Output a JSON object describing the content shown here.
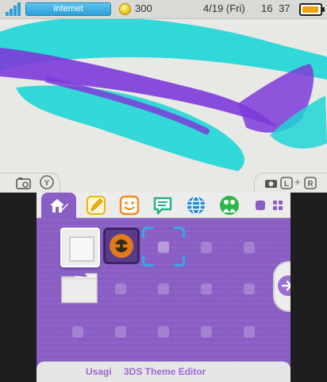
{
  "status_bar": {
    "connection_label": "Internet",
    "coin_count": "300",
    "date": "4/19 (Fri)",
    "time": "16 37",
    "icons": [
      "signal-strength-icon",
      "coin-icon",
      "battery-icon"
    ]
  },
  "top_controls": {
    "left_tab_icons": [
      "camera-icon",
      "y-button-icon"
    ],
    "right_tab_icons": [
      "camera-icon",
      "l-button-icon",
      "r-button-icon"
    ],
    "right_tab_plus": "+"
  },
  "app_bar": {
    "apps": [
      {
        "name": "home-settings-icon",
        "color": "#8a5ec4"
      },
      {
        "name": "notes-pencil-icon",
        "color": "#f2b400"
      },
      {
        "name": "friends-smiley-icon",
        "color": "#f28a1e"
      },
      {
        "name": "notifications-speech-icon",
        "color": "#23b08a"
      },
      {
        "name": "browser-globe-icon",
        "color": "#1c8bd8"
      },
      {
        "name": "miiverse-icon",
        "color": "#2fb84a"
      }
    ],
    "layout_icons": [
      "single-view-icon",
      "grid-view-icon"
    ]
  },
  "theme": {
    "accent_color": "#8a5ec4",
    "wallpaper_colors": [
      "#1fd6d6",
      "#7c3bd9"
    ]
  },
  "footer": {
    "author": "Usagi",
    "editor": "3DS Theme Editor"
  }
}
